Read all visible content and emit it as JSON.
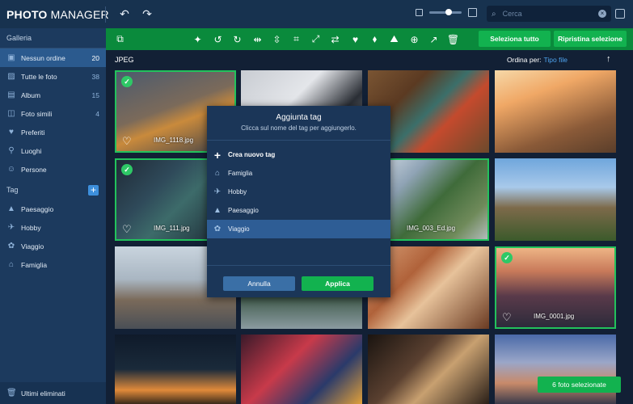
{
  "app": {
    "logo_bold": "PHOTO",
    "logo_light": " MANAGER"
  },
  "search": {
    "placeholder": "Cerca"
  },
  "sidebar": {
    "gallery_header": "Galleria",
    "items": [
      {
        "label": "Nessun ordine",
        "count": "20",
        "icon": "stack-icon",
        "active": true
      },
      {
        "label": "Tutte le foto",
        "count": "38",
        "icon": "photo-icon"
      },
      {
        "label": "Album",
        "count": "15",
        "icon": "album-icon"
      },
      {
        "label": "Foto simili",
        "count": "4",
        "icon": "similar-icon"
      },
      {
        "label": "Preferiti",
        "count": "",
        "icon": "heart-icon"
      },
      {
        "label": "Luoghi",
        "count": "",
        "icon": "pin-icon"
      },
      {
        "label": "Persone",
        "count": "",
        "icon": "person-icon"
      }
    ],
    "tag_header": "Tag",
    "tags": [
      {
        "label": "Paesaggio",
        "icon": "landscape-icon"
      },
      {
        "label": "Hobby",
        "icon": "plane-icon"
      },
      {
        "label": "Viaggio",
        "icon": "palm-icon"
      },
      {
        "label": "Famiglia",
        "icon": "house-icon"
      }
    ],
    "footer": "Ultimi eliminati"
  },
  "toolbar": {
    "select_all": "Seleziona tutto",
    "reset_selection": "Ripristina selezione"
  },
  "content": {
    "group_label": "JPEG",
    "sort_label": "Ordina per:",
    "sort_value": "Tipo file"
  },
  "photos": [
    {
      "name": "IMG_1118.jpg",
      "selected": true
    },
    {
      "name": "",
      "selected": false
    },
    {
      "name": "",
      "selected": false
    },
    {
      "name": "",
      "selected": false
    },
    {
      "name": "IMG_111.jpg",
      "selected": true
    },
    {
      "name": "",
      "selected": false
    },
    {
      "name": "IMG_003_Ed.jpg",
      "selected": true
    },
    {
      "name": "",
      "selected": true
    },
    {
      "name": "",
      "selected": false
    },
    {
      "name": "",
      "selected": false
    },
    {
      "name": "",
      "selected": false
    },
    {
      "name": "IMG_0001.jpg",
      "selected": true
    }
  ],
  "modal": {
    "title": "Aggiunta tag",
    "subtitle": "Clicca sul nome del tag per aggiungerlo.",
    "create_label": "Crea nuovo tag",
    "tags": [
      "Famiglia",
      "Hobby",
      "Paesaggio",
      "Viaggio"
    ],
    "selected_tag": "Viaggio",
    "cancel_label": "Annulla",
    "apply_label": "Applica"
  },
  "selection_status": "6 foto selezionate",
  "colors": {
    "toolbar_green": "#0a8a3c",
    "button_green": "#12b24f",
    "sidebar_blue": "#1c3a5e",
    "accent_blue": "#3d8fdc",
    "selection_outline": "#22c25c"
  }
}
